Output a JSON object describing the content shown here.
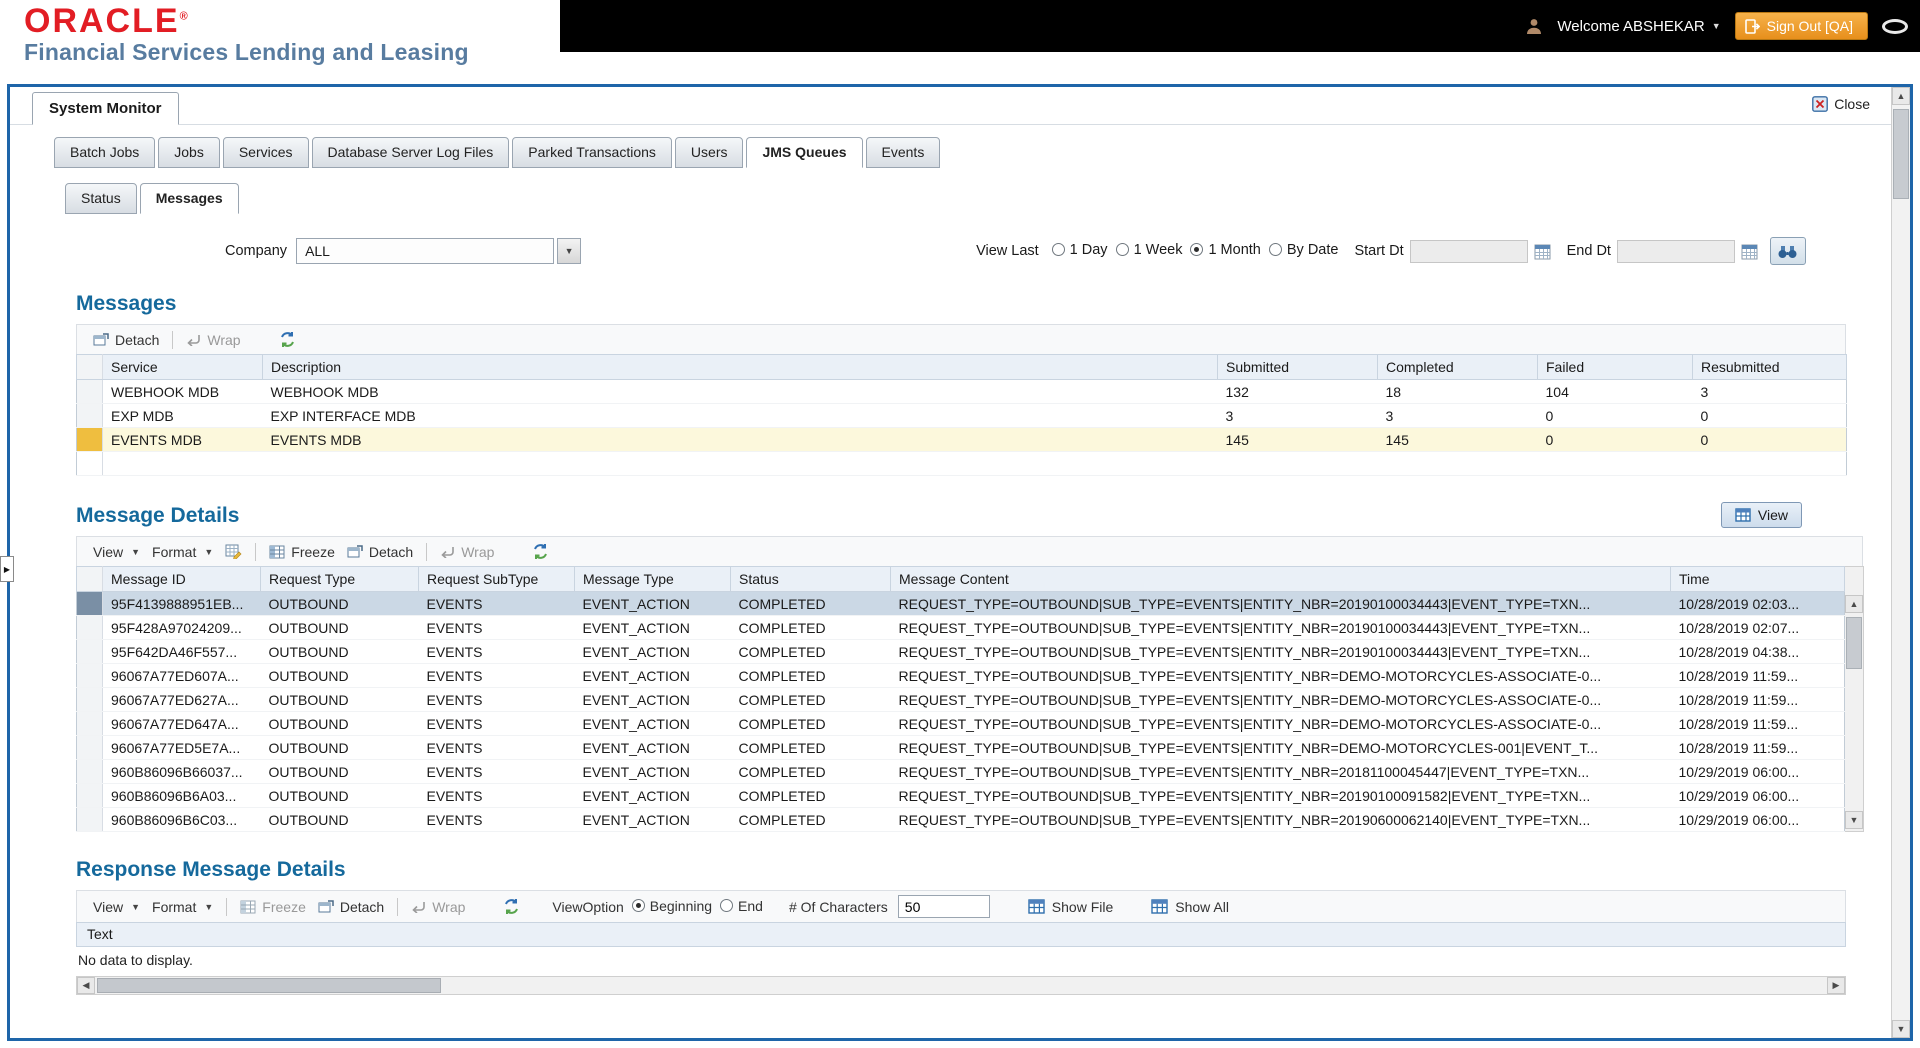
{
  "colors": {
    "brand_red": "#e21d24",
    "subtitle_blue": "#587ca0",
    "window_border_blue": "#1e65a9",
    "heading_blue": "#15699c",
    "signout_orange": "#e78f1c",
    "selected_row_yellow": "#fcf8dc",
    "selected_row_blue": "#cbd8e5"
  },
  "header": {
    "brand": "ORACLE",
    "registered": "®",
    "subtitle": "Financial Services Lending and Leasing",
    "welcome": "Welcome ABSHEKAR",
    "signout": "Sign Out [QA]"
  },
  "window": {
    "title": "System Monitor",
    "close": "Close"
  },
  "tabs": [
    "Batch Jobs",
    "Jobs",
    "Services",
    "Database Server Log Files",
    "Parked Transactions",
    "Users",
    "JMS Queues",
    "Events"
  ],
  "active_tab": "JMS Queues",
  "subtabs": [
    "Status",
    "Messages"
  ],
  "active_subtab": "Messages",
  "filters": {
    "company_label": "Company",
    "company_value": "ALL",
    "view_last_label": "View Last",
    "view_last_options": [
      "1 Day",
      "1 Week",
      "1 Month",
      "By Date"
    ],
    "view_last_selected": "1 Month",
    "start_dt_label": "Start Dt",
    "start_dt_value": "",
    "end_dt_label": "End Dt",
    "end_dt_value": ""
  },
  "messages": {
    "title": "Messages",
    "toolbar": {
      "detach": "Detach",
      "wrap": "Wrap"
    },
    "columns": [
      "Service",
      "Description",
      "Submitted",
      "Completed",
      "Failed",
      "Resubmitted"
    ],
    "rows": [
      [
        "WEBHOOK MDB",
        "WEBHOOK MDB",
        "132",
        "18",
        "104",
        "3"
      ],
      [
        "EXP MDB",
        "EXP INTERFACE MDB",
        "3",
        "3",
        "0",
        "0"
      ],
      [
        "EVENTS MDB",
        "EVENTS MDB",
        "145",
        "145",
        "0",
        "0"
      ]
    ],
    "selected_row": 2
  },
  "message_details": {
    "title": "Message Details",
    "view_button": "View",
    "toolbar": {
      "view": "View",
      "format": "Format",
      "freeze": "Freeze",
      "detach": "Detach",
      "wrap": "Wrap"
    },
    "columns": [
      "Message ID",
      "Request Type",
      "Request SubType",
      "Message Type",
      "Status",
      "Message Content",
      "Time"
    ],
    "rows": [
      [
        "95F4139888951EB...",
        "OUTBOUND",
        "EVENTS",
        "EVENT_ACTION",
        "COMPLETED",
        "REQUEST_TYPE=OUTBOUND|SUB_TYPE=EVENTS|ENTITY_NBR=20190100034443|EVENT_TYPE=TXN...",
        "10/28/2019 02:03..."
      ],
      [
        "95F428A97024209...",
        "OUTBOUND",
        "EVENTS",
        "EVENT_ACTION",
        "COMPLETED",
        "REQUEST_TYPE=OUTBOUND|SUB_TYPE=EVENTS|ENTITY_NBR=20190100034443|EVENT_TYPE=TXN...",
        "10/28/2019 02:07..."
      ],
      [
        "95F642DA46F557...",
        "OUTBOUND",
        "EVENTS",
        "EVENT_ACTION",
        "COMPLETED",
        "REQUEST_TYPE=OUTBOUND|SUB_TYPE=EVENTS|ENTITY_NBR=20190100034443|EVENT_TYPE=TXN...",
        "10/28/2019 04:38..."
      ],
      [
        "96067A77ED607A...",
        "OUTBOUND",
        "EVENTS",
        "EVENT_ACTION",
        "COMPLETED",
        "REQUEST_TYPE=OUTBOUND|SUB_TYPE=EVENTS|ENTITY_NBR=DEMO-MOTORCYCLES-ASSOCIATE-0...",
        "10/28/2019 11:59..."
      ],
      [
        "96067A77ED627A...",
        "OUTBOUND",
        "EVENTS",
        "EVENT_ACTION",
        "COMPLETED",
        "REQUEST_TYPE=OUTBOUND|SUB_TYPE=EVENTS|ENTITY_NBR=DEMO-MOTORCYCLES-ASSOCIATE-0...",
        "10/28/2019 11:59..."
      ],
      [
        "96067A77ED647A...",
        "OUTBOUND",
        "EVENTS",
        "EVENT_ACTION",
        "COMPLETED",
        "REQUEST_TYPE=OUTBOUND|SUB_TYPE=EVENTS|ENTITY_NBR=DEMO-MOTORCYCLES-ASSOCIATE-0...",
        "10/28/2019 11:59..."
      ],
      [
        "96067A77ED5E7A...",
        "OUTBOUND",
        "EVENTS",
        "EVENT_ACTION",
        "COMPLETED",
        "REQUEST_TYPE=OUTBOUND|SUB_TYPE=EVENTS|ENTITY_NBR=DEMO-MOTORCYCLES-001|EVENT_T...",
        "10/28/2019 11:59..."
      ],
      [
        "960B86096B66037...",
        "OUTBOUND",
        "EVENTS",
        "EVENT_ACTION",
        "COMPLETED",
        "REQUEST_TYPE=OUTBOUND|SUB_TYPE=EVENTS|ENTITY_NBR=20181100045447|EVENT_TYPE=TXN...",
        "10/29/2019 06:00..."
      ],
      [
        "960B86096B6A03...",
        "OUTBOUND",
        "EVENTS",
        "EVENT_ACTION",
        "COMPLETED",
        "REQUEST_TYPE=OUTBOUND|SUB_TYPE=EVENTS|ENTITY_NBR=20190100091582|EVENT_TYPE=TXN...",
        "10/29/2019 06:00..."
      ],
      [
        "960B86096B6C03...",
        "OUTBOUND",
        "EVENTS",
        "EVENT_ACTION",
        "COMPLETED",
        "REQUEST_TYPE=OUTBOUND|SUB_TYPE=EVENTS|ENTITY_NBR=20190600062140|EVENT_TYPE=TXN...",
        "10/29/2019 06:00..."
      ]
    ],
    "selected_row": 0
  },
  "response_details": {
    "title": "Response Message Details",
    "toolbar": {
      "view": "View",
      "format": "Format",
      "freeze": "Freeze",
      "detach": "Detach",
      "wrap": "Wrap",
      "view_option_label": "ViewOption",
      "view_options": [
        "Beginning",
        "End"
      ],
      "view_option_selected": "Beginning",
      "chars_label": "# Of Characters",
      "chars_value": "50",
      "show_file": "Show File",
      "show_all": "Show All"
    },
    "columns": [
      "Text"
    ],
    "empty_text": "No data to display."
  }
}
